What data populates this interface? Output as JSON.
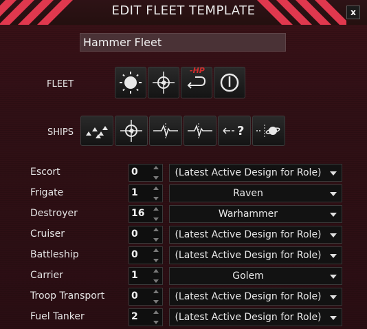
{
  "window": {
    "title": "EDIT FLEET TEMPLATE",
    "close_label": "x",
    "accent_color": "#e0384e"
  },
  "fleet_name": {
    "value": "Hammer Fleet"
  },
  "fleet_section": {
    "label": "FLEET",
    "buttons": [
      {
        "icon": "aggression-icon"
      },
      {
        "icon": "fleet-target-icon"
      },
      {
        "icon": "retreat-low-hp-icon",
        "text": "-HP"
      },
      {
        "icon": "power-icon"
      }
    ]
  },
  "ships_section": {
    "label": "SHIPS",
    "buttons": [
      {
        "icon": "formation-icon"
      },
      {
        "icon": "ship-target-icon"
      },
      {
        "icon": "signal-icon"
      },
      {
        "icon": "signal-alt-icon"
      },
      {
        "icon": "unknown-target-icon"
      },
      {
        "icon": "planet-icon"
      }
    ]
  },
  "roles": [
    {
      "name": "Escort",
      "count": "0",
      "design": "(Latest Active Design for Role)"
    },
    {
      "name": "Frigate",
      "count": "1",
      "design": "Raven"
    },
    {
      "name": "Destroyer",
      "count": "16",
      "design": "Warhammer"
    },
    {
      "name": "Cruiser",
      "count": "0",
      "design": "(Latest Active Design for Role)"
    },
    {
      "name": "Battleship",
      "count": "0",
      "design": "(Latest Active Design for Role)"
    },
    {
      "name": "Carrier",
      "count": "1",
      "design": "Golem"
    },
    {
      "name": "Troop Transport",
      "count": "0",
      "design": "(Latest Active Design for Role)"
    },
    {
      "name": "Fuel Tanker",
      "count": "2",
      "design": "(Latest Active Design for Role)"
    }
  ]
}
